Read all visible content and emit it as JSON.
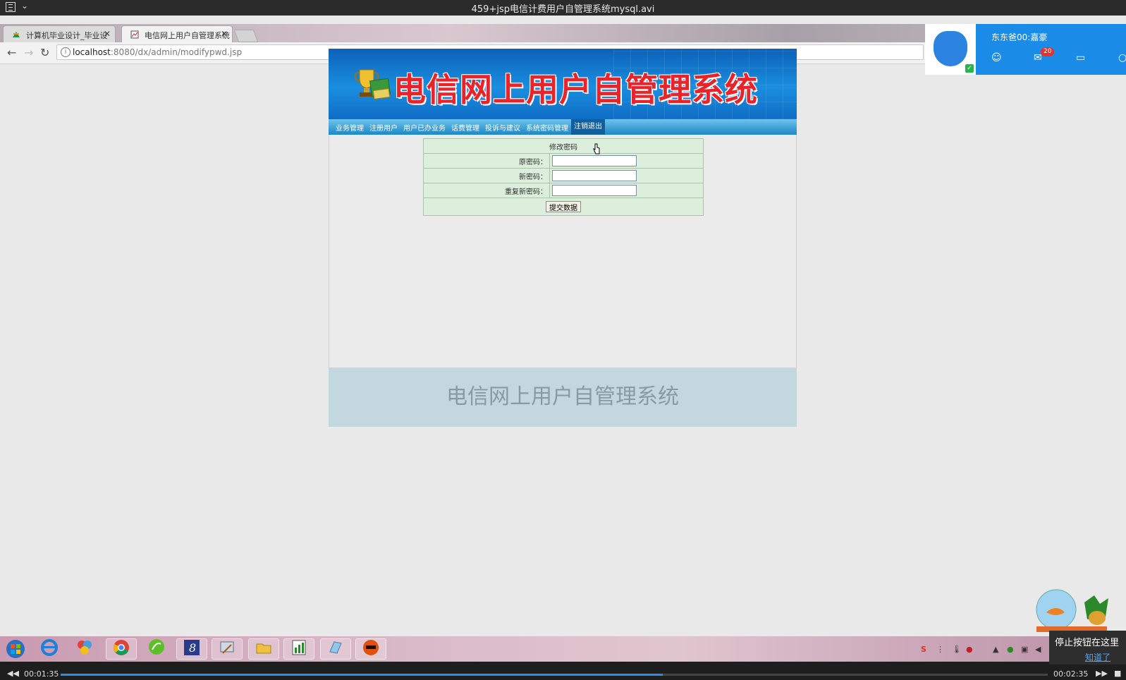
{
  "player": {
    "title": "459+jsp电信计费用户自管理系统mysql.avi",
    "time_elapsed": "00:01:35",
    "time_total": "00:02:35",
    "progress_fraction": 0.61
  },
  "browser": {
    "tabs": [
      {
        "label": "计算机毕业设计_毕业设",
        "active": false
      },
      {
        "label": "电信网上用户自管理系统",
        "active": true
      }
    ],
    "url_host": "localhost",
    "url_path": ":8080/dx/admin/modifypwd.jsp"
  },
  "page": {
    "banner_title": "电信网上用户自管理系统",
    "nav": [
      "业务管理",
      "注册用户",
      "用户已办业务",
      "话费管理",
      "投诉与建议",
      "系统密码管理",
      "注销退出"
    ],
    "form": {
      "caption": "修改密码",
      "old_password_label": "原密码：",
      "new_password_label": "新密码：",
      "repeat_password_label": "重复新密码：",
      "submit_label": "提交数据"
    },
    "footer_text": "电信网上用户自管理系统"
  },
  "qq": {
    "name": "东东爸00:嘉豪",
    "mail_badge": "20"
  },
  "tray": {
    "notice_text": "停止按钮在这里",
    "notice_link": "知道了"
  },
  "colors": {
    "banner_blue": "#1a8ee0",
    "banner_title_red": "#e8232a",
    "form_bg": "#dcefdc",
    "footer_bg": "#c3d8de",
    "qq_blue": "#1b8be8"
  }
}
